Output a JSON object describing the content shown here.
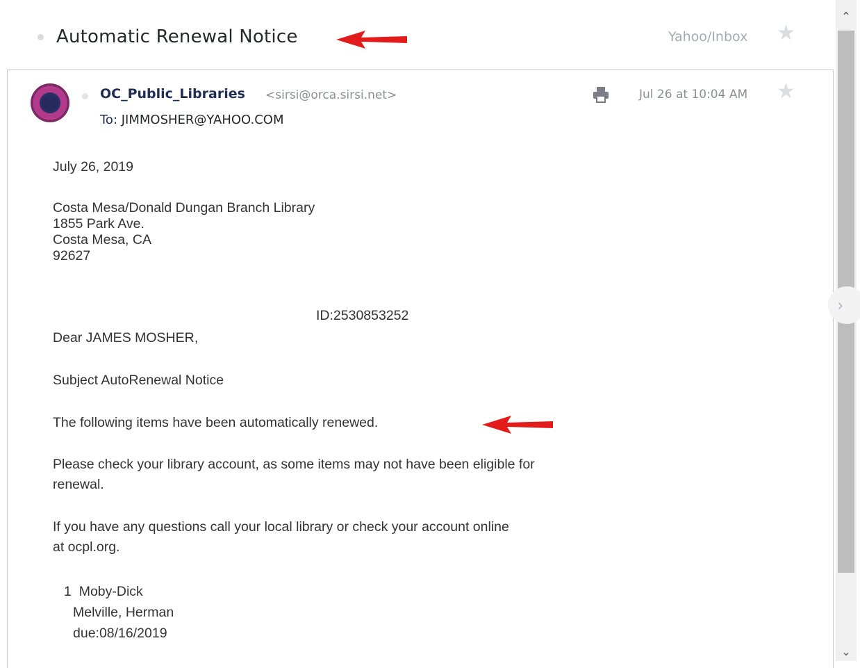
{
  "header": {
    "subject": "Automatic Renewal Notice",
    "folder": "Yahoo/Inbox"
  },
  "message": {
    "sender_name": "OC_Public_Libraries",
    "sender_email": "<sirsi@orca.sirsi.net>",
    "to_label": "To:",
    "to_value": "JIMMOSHER@YAHOO.COM",
    "date": "Jul 26 at 10:04 AM"
  },
  "body": {
    "date_line": "July 26, 2019",
    "address": [
      "Costa Mesa/Donald Dungan Branch Library",
      "1855 Park Ave.",
      "Costa Mesa, CA",
      "92627"
    ],
    "id_line": "ID:2530853252",
    "greeting": "Dear JAMES MOSHER,",
    "subject_line": "Subject AutoRenewal Notice",
    "renewed_line": "The following items have been automatically renewed.",
    "check_account": [
      "Please check your library account, as some items may not have been eligible for",
      "renewal."
    ],
    "questions": [
      "If you have any questions call your local library or check your account online",
      "at ocpl.org."
    ],
    "item": {
      "number": "1",
      "title": "Moby-Dick",
      "author": "Melville, Herman",
      "due": "due:08/16/2019"
    }
  },
  "icons": {
    "star": "star-icon",
    "print": "printer-icon",
    "next": "chevron-right-icon",
    "scroll_up": "chevron-up-icon",
    "scroll_down": "chevron-down-icon"
  },
  "colors": {
    "annotation_arrow": "#e21b1b",
    "sender_name": "#1f2c54",
    "muted_text": "#8c8f96"
  }
}
